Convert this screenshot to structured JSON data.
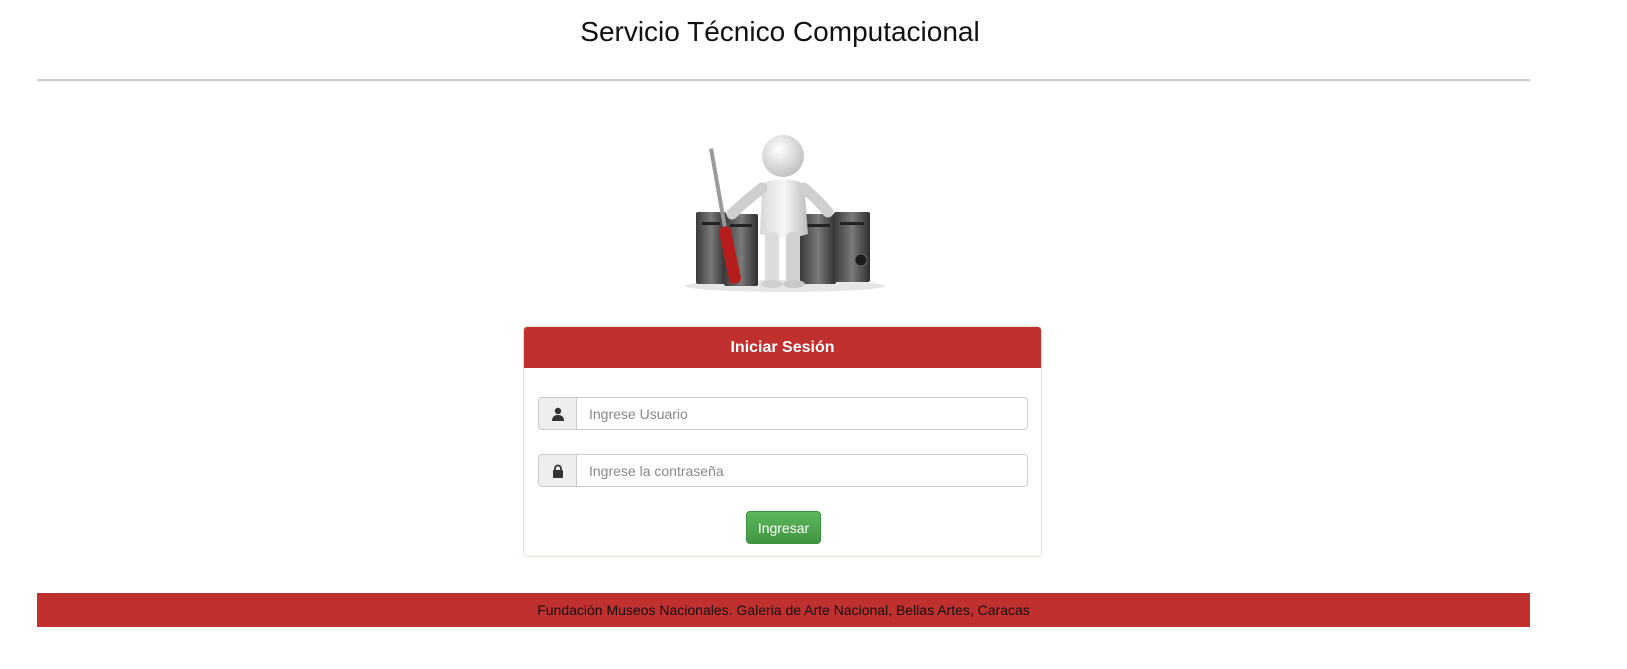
{
  "header": {
    "title": "Servicio Técnico Computacional"
  },
  "hero": {
    "icon": "technician-with-screwdriver-and-servers-illustration"
  },
  "login": {
    "heading": "Iniciar Sesión",
    "username": {
      "icon": "user-icon",
      "value": "",
      "placeholder": "Ingrese Usuario"
    },
    "password": {
      "icon": "lock-icon",
      "value": "",
      "placeholder": "Ingrese la contraseña"
    },
    "submit_label": "Ingresar"
  },
  "footer": {
    "text": "Fundación Museos Nacionales. Galeria de Arte Nacional, Bellas Artes, Caracas"
  },
  "colors": {
    "brand_red": "#c0302f",
    "submit_green": "#4cae4c"
  }
}
